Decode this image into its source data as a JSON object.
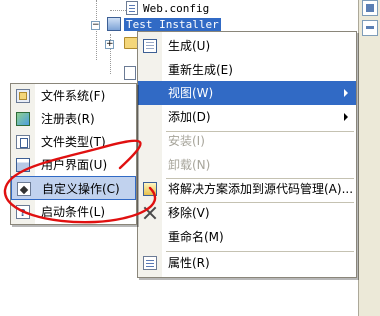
{
  "tree": {
    "items": [
      {
        "label": "Web.config",
        "selected": false
      },
      {
        "label": "Test Installer",
        "selected": true
      }
    ],
    "expander_minus": "−",
    "expander_plus": "+"
  },
  "context_menu": {
    "items": [
      {
        "label": "生成(U)",
        "icon": "build-grid-icon",
        "disabled": false,
        "submenu": false
      },
      {
        "label": "重新生成(E)",
        "icon": null,
        "disabled": false,
        "submenu": false
      },
      {
        "label": "视图(W)",
        "icon": null,
        "disabled": false,
        "submenu": true,
        "highlight": true
      },
      {
        "label": "添加(D)",
        "icon": null,
        "disabled": false,
        "submenu": true
      },
      {
        "label": "安装(I)",
        "icon": null,
        "disabled": true,
        "submenu": false
      },
      {
        "label": "卸载(N)",
        "icon": null,
        "disabled": true,
        "submenu": false
      },
      {
        "label": "将解决方案添加到源代码管理(A)...",
        "icon": "solution-icon",
        "disabled": false,
        "submenu": false
      },
      {
        "label": "移除(V)",
        "icon": "close-x-icon",
        "disabled": false,
        "submenu": false
      },
      {
        "label": "重命名(M)",
        "icon": null,
        "disabled": false,
        "submenu": false
      },
      {
        "label": "属性(R)",
        "icon": "properties-icon",
        "disabled": false,
        "submenu": false
      }
    ]
  },
  "view_submenu": {
    "items": [
      {
        "label": "文件系统(F)",
        "icon": "file-system-icon"
      },
      {
        "label": "注册表(R)",
        "icon": "registry-icon"
      },
      {
        "label": "文件类型(T)",
        "icon": "file-types-icon"
      },
      {
        "label": "用户界面(U)",
        "icon": "user-interface-icon"
      },
      {
        "label": "自定义操作(C)",
        "icon": "custom-actions-icon",
        "highlight": true
      },
      {
        "label": "启动条件(L)",
        "icon": "launch-conditions-icon"
      }
    ]
  },
  "colors": {
    "selection": "#316ac5",
    "menu_hover": "#c1d2ee",
    "annotation": "#e01010",
    "disabled_text": "#a7a59b"
  }
}
